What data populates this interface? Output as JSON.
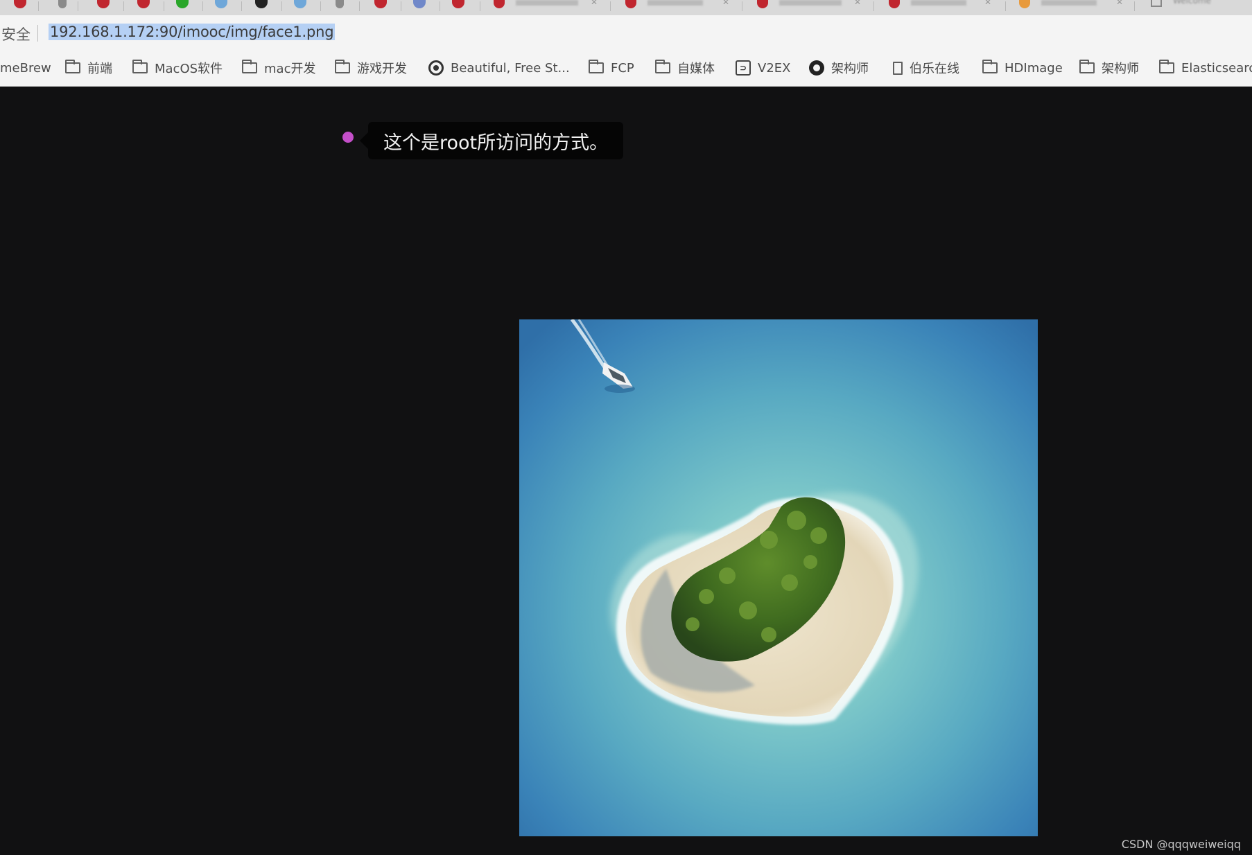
{
  "address_bar": {
    "security_label": "安全",
    "url": "192.168.1.172:90/imooc/img/face1.png"
  },
  "bookmarks": [
    {
      "label": "meBrew",
      "icon": "none"
    },
    {
      "label": "前端",
      "icon": "folder-icon"
    },
    {
      "label": "MacOS软件",
      "icon": "folder-icon"
    },
    {
      "label": "mac开发",
      "icon": "folder-icon"
    },
    {
      "label": "游戏开发",
      "icon": "folder-icon"
    },
    {
      "label": "Beautiful, Free St...",
      "icon": "circle-icon"
    },
    {
      "label": "FCP",
      "icon": "folder-icon"
    },
    {
      "label": "自媒体",
      "icon": "folder-icon"
    },
    {
      "label": "V2EX",
      "icon": "v2ex-icon"
    },
    {
      "label": "架构师",
      "icon": "github-icon"
    },
    {
      "label": "伯乐在线",
      "icon": "page-icon"
    },
    {
      "label": "HDImage",
      "icon": "folder-icon"
    },
    {
      "label": "架构师",
      "icon": "folder-icon"
    },
    {
      "label": "Elasticsearc",
      "icon": "folder-icon"
    }
  ],
  "tabs": {
    "last_tab_title": "Welcome"
  },
  "caption": {
    "text": "这个是root所访问的方式。"
  },
  "watermark": {
    "text": "CSDN @qqqweiweiqq"
  },
  "image": {
    "subject": "heart-shaped island with boat",
    "colors": {
      "ocean_deep": "#2f74b0",
      "ocean_shallow": "#7cc7c9",
      "sand": "#e7dcc4",
      "trees": "#3e6b1d"
    }
  },
  "colors": {
    "caption_dot": "#c44fc9",
    "url_selection": "#b5d0f4",
    "background": "#111112"
  }
}
